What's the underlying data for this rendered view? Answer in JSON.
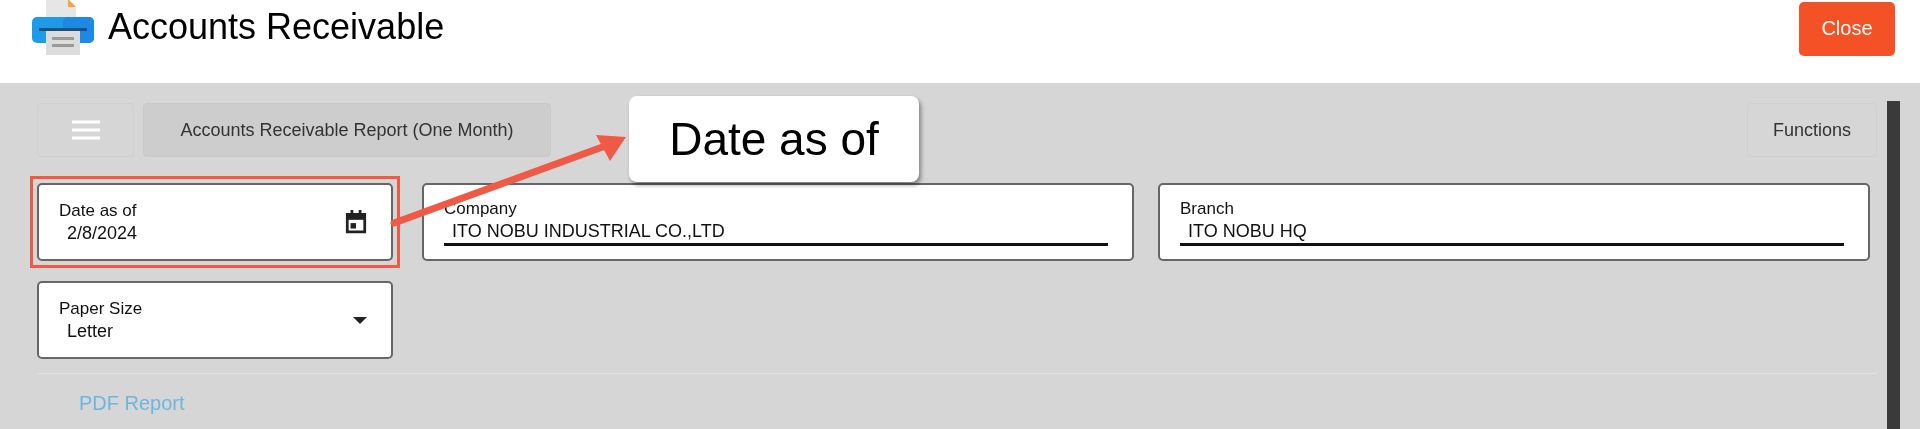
{
  "header": {
    "title": "Accounts Receivable",
    "close_button": "Close"
  },
  "toolbar": {
    "report_tab": "Accounts Receivable Report (One Month)",
    "functions_button": "Functions"
  },
  "fields": [
    {
      "kind": "date",
      "label": "Date as of",
      "value": "2/8/2024",
      "highlighted": true
    },
    {
      "kind": "text",
      "label": "Company",
      "value": "ITO NOBU INDUSTRIAL CO.,LTD",
      "highlighted": false
    },
    {
      "kind": "text",
      "label": "Branch",
      "value": "ITO NOBU HQ",
      "highlighted": false
    },
    {
      "kind": "select",
      "label": "Paper Size",
      "value": "Letter",
      "highlighted": false
    }
  ],
  "callout": {
    "text": "Date as of"
  },
  "link": "PDF Report"
}
